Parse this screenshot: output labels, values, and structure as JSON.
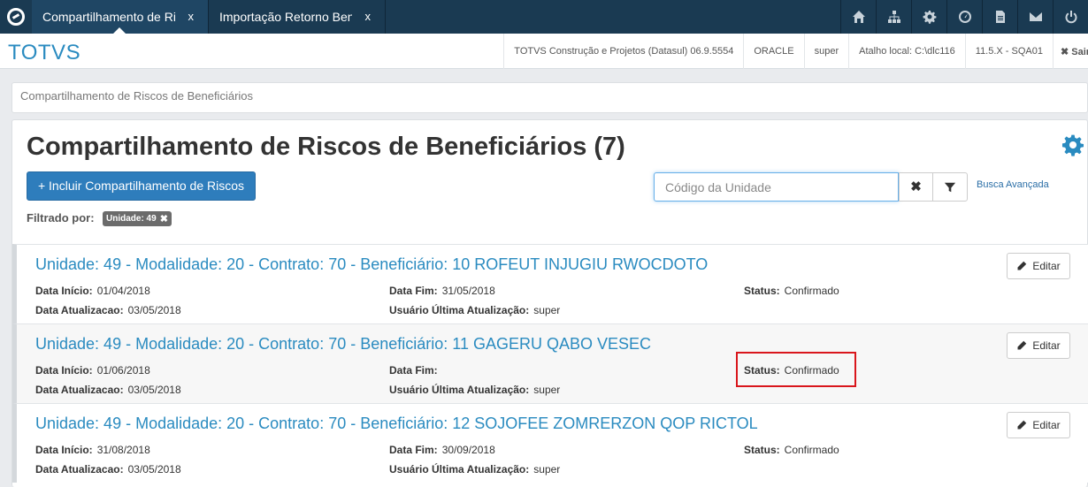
{
  "tabs": [
    {
      "label": "Compartilhamento de Riscos de Beneficiários",
      "close": "x",
      "active": true
    },
    {
      "label": "Importação Retorno Beneficiários",
      "close": "x",
      "active": false
    }
  ],
  "toolbar_icons": [
    "home-icon",
    "sitemap-icon",
    "gear-icon",
    "dashboard-icon",
    "document-icon",
    "mail-icon",
    "power-icon"
  ],
  "brand": "TOTVS",
  "header_info": {
    "product": "TOTVS Construção e Projetos (Datasul) 06.9.5554",
    "database": "ORACLE",
    "user": "super",
    "shortcut": "Atalho local: C:\\dlc116",
    "version": "11.5.X - SQA01",
    "exit": "✖ Sair"
  },
  "breadcrumb": "Compartilhamento de Riscos de Beneficiários",
  "page_title": "Compartilhamento de Riscos de Beneficiários (7)",
  "add_button": "+ Incluir Compartilhamento de Riscos",
  "search": {
    "placeholder": "Código da Unidade",
    "value": ""
  },
  "clear_label": "✖",
  "advanced_search": "Busca Avançada",
  "filter": {
    "label": "Filtrado por:",
    "tag": "Unidade: 49",
    "tag_close": "✖"
  },
  "labels": {
    "start": "Data Início:",
    "end": "Data Fim:",
    "status": "Status:",
    "updated": "Data Atualizacao:",
    "last_user": "Usuário Última Atualização:",
    "edit": "Editar"
  },
  "rows": [
    {
      "title": "Unidade: 49 - Modalidade: 20 - Contrato: 70 - Beneficiário: 10 ROFEUT INJUGIU RWOCDOTO",
      "start": "01/04/2018",
      "end": "31/05/2018",
      "status": "Confirmado",
      "updated": "03/05/2018",
      "last_user": "super"
    },
    {
      "title": "Unidade: 49 - Modalidade: 20 - Contrato: 70 - Beneficiário: 11 GAGERU QABO VESEC",
      "start": "01/06/2018",
      "end": "",
      "status": "Confirmado",
      "updated": "03/05/2018",
      "last_user": "super"
    },
    {
      "title": "Unidade: 49 - Modalidade: 20 - Contrato: 70 - Beneficiário: 12 SOJOFEE ZOMRERZON QOP RICTOL",
      "start": "31/08/2018",
      "end": "30/09/2018",
      "status": "Confirmado",
      "updated": "03/05/2018",
      "last_user": "super"
    }
  ],
  "colors": {
    "accent": "#2a8bc0",
    "topbar": "#1a3a52",
    "primary_button": "#2e7dbc",
    "highlight": "#d9161c"
  }
}
